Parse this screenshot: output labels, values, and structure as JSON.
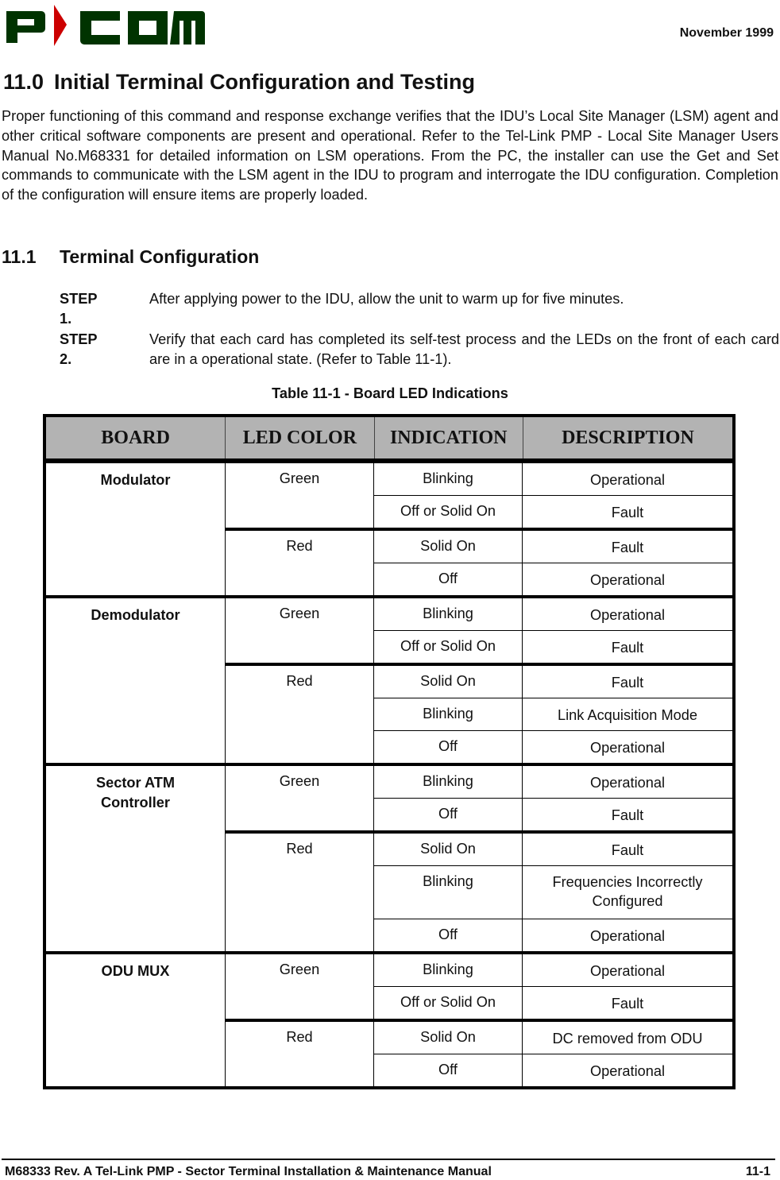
{
  "header": {
    "logo_text": "P-COM",
    "logo_colors": {
      "letters": "#003300",
      "arrow": "#cc0000"
    },
    "date": "November 1999"
  },
  "section": {
    "number": "11.0",
    "title": "Initial Terminal Configuration and Testing",
    "paragraph": "Proper functioning of this command and response exchange verifies that the IDU’s Local Site Manager (LSM) agent and other critical software components are present and operational. Refer to the Tel-Link PMP - Local Site Manager Users Manual No.M68331 for detailed information on LSM operations. From the PC, the installer can use the Get and Set commands to communicate with the LSM agent in the IDU to program and interrogate the IDU configuration. Completion of the configuration will ensure items are properly loaded."
  },
  "subsection": {
    "number": "11.1",
    "title": "Terminal Configuration",
    "steps": [
      {
        "label": "STEP 1.",
        "text": "After applying power to the IDU, allow the unit to warm up for five minutes."
      },
      {
        "label": "STEP 2.",
        "text": "Verify that each card has completed its self-test process and the LEDs on the front of each card are in a operational state. (Refer to Table 11-1)."
      }
    ]
  },
  "table": {
    "caption": "Table 11-1 - Board LED Indications",
    "header_bg": "#b3b3b3",
    "columns": [
      "BOARD",
      "LED COLOR",
      "INDICATION",
      "DESCRIPTION"
    ],
    "boards": [
      {
        "name": "Modulator",
        "colors": [
          {
            "color": "Green",
            "rows": [
              {
                "indication": "Blinking",
                "description": "Operational"
              },
              {
                "indication": "Off or Solid On",
                "description": "Fault"
              }
            ]
          },
          {
            "color": "Red",
            "rows": [
              {
                "indication": "Solid On",
                "description": "Fault"
              },
              {
                "indication": "Off",
                "description": "Operational"
              }
            ]
          }
        ]
      },
      {
        "name": "Demodulator",
        "colors": [
          {
            "color": "Green",
            "rows": [
              {
                "indication": "Blinking",
                "description": "Operational"
              },
              {
                "indication": "Off or Solid On",
                "description": "Fault"
              }
            ]
          },
          {
            "color": "Red",
            "rows": [
              {
                "indication": "Solid On",
                "description": "Fault"
              },
              {
                "indication": "Blinking",
                "description": "Link Acquisition Mode"
              },
              {
                "indication": "Off",
                "description": "Operational"
              }
            ]
          }
        ]
      },
      {
        "name": "Sector ATM Controller",
        "colors": [
          {
            "color": "Green",
            "rows": [
              {
                "indication": "Blinking",
                "description": "Operational"
              },
              {
                "indication": "Off",
                "description": "Fault"
              }
            ]
          },
          {
            "color": "Red",
            "rows": [
              {
                "indication": "Solid On",
                "description": "Fault"
              },
              {
                "indication": "Blinking",
                "description": "Frequencies Incorrectly Configured"
              },
              {
                "indication": "Off",
                "description": "Operational"
              }
            ]
          }
        ]
      },
      {
        "name": "ODU MUX",
        "colors": [
          {
            "color": "Green",
            "rows": [
              {
                "indication": "Blinking",
                "description": "Operational"
              },
              {
                "indication": "Off or Solid On",
                "description": "Fault"
              }
            ]
          },
          {
            "color": "Red",
            "rows": [
              {
                "indication": "Solid On",
                "description": "DC removed from ODU"
              },
              {
                "indication": "Off",
                "description": "Operational"
              }
            ]
          }
        ]
      }
    ]
  },
  "footer": {
    "left": "M68333 Rev. A Tel-Link PMP - Sector Terminal Installation & Maintenance Manual",
    "right": "11-1"
  }
}
